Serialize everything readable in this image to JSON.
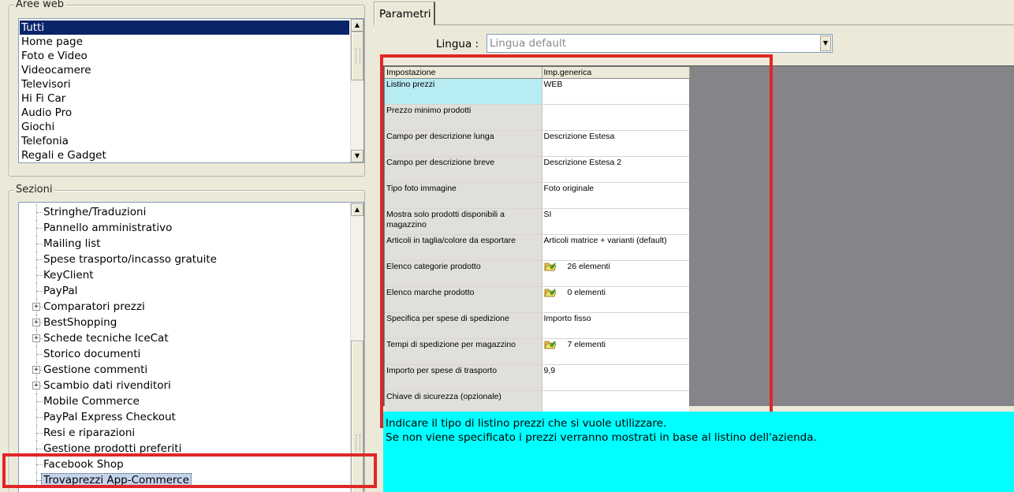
{
  "aree_web": {
    "title": "Aree web",
    "items": [
      {
        "label": "Tutti",
        "selected": true
      },
      {
        "label": "Home page"
      },
      {
        "label": "Foto e Video"
      },
      {
        "label": "Videocamere"
      },
      {
        "label": "Televisori"
      },
      {
        "label": "Hi Fi Car"
      },
      {
        "label": "Audio Pro"
      },
      {
        "label": "Giochi"
      },
      {
        "label": "Telefonia"
      },
      {
        "label": "Regali e Gadget"
      }
    ]
  },
  "sezioni": {
    "title": "Sezioni",
    "items": [
      {
        "label": "Stringhe/Traduzioni",
        "expandable": false
      },
      {
        "label": "Pannello amministrativo",
        "expandable": false
      },
      {
        "label": "Mailing list",
        "expandable": false
      },
      {
        "label": "Spese trasporto/incasso gratuite",
        "expandable": false
      },
      {
        "label": "KeyClient",
        "expandable": false
      },
      {
        "label": "PayPal",
        "expandable": false
      },
      {
        "label": "Comparatori prezzi",
        "expandable": true
      },
      {
        "label": "BestShopping",
        "expandable": true
      },
      {
        "label": "Schede tecniche IceCat",
        "expandable": true
      },
      {
        "label": "Storico documenti",
        "expandable": false
      },
      {
        "label": "Gestione commenti",
        "expandable": true
      },
      {
        "label": "Scambio dati rivenditori",
        "expandable": true
      },
      {
        "label": "Mobile Commerce",
        "expandable": false
      },
      {
        "label": "PayPal Express Checkout",
        "expandable": false
      },
      {
        "label": "Resi e riparazioni",
        "expandable": false
      },
      {
        "label": "Gestione prodotti preferiti",
        "expandable": false
      },
      {
        "label": "Facebook Shop",
        "expandable": false
      },
      {
        "label": "Trovaprezzi App-Commerce",
        "expandable": false,
        "selected": true
      }
    ]
  },
  "tab": {
    "label": "Parametri"
  },
  "lingua": {
    "label": "Lingua :",
    "value": "Lingua default"
  },
  "grid": {
    "headers": {
      "key": "Impostazione",
      "value": "Imp.generica"
    },
    "rows": [
      {
        "key": "Listino prezzi",
        "value": "WEB",
        "icon": false
      },
      {
        "key": "Prezzo minimo prodotti",
        "value": "",
        "icon": false
      },
      {
        "key": "Campo per descrizione lunga",
        "value": "Descrizione Estesa",
        "icon": false
      },
      {
        "key": "Campo per descrizione breve",
        "value": "Descrizione Estesa 2",
        "icon": false
      },
      {
        "key": "Tipo foto immagine",
        "value": "Foto originale",
        "icon": false
      },
      {
        "key": "Mostra solo prodotti disponibili a magazzino",
        "value": "SI",
        "icon": false
      },
      {
        "key": "Articoli in taglia/colore da esportare",
        "value": "Articoli matrice + varianti (default)",
        "icon": false
      },
      {
        "key": "Elenco categorie prodotto",
        "value": "26 elementi",
        "icon": true
      },
      {
        "key": "Elenco marche prodotto",
        "value": "0 elementi",
        "icon": true
      },
      {
        "key": "Specifica per spese di spedizione",
        "value": "Importo fisso",
        "icon": false
      },
      {
        "key": "Tempi di spedizione per magazzino",
        "value": "7 elementi",
        "icon": true
      },
      {
        "key": "Importo per spese di trasporto",
        "value": "9,9",
        "icon": false
      },
      {
        "key": "Chiave di sicurezza (opzionale)",
        "value": "",
        "icon": false
      }
    ]
  },
  "hint": {
    "line1": "Indicare il tipo di listino prezzi che si vuole utilizzare.",
    "line2": "Se non viene specificato i prezzi verranno mostrati in base al listino dell'azienda."
  },
  "colors": {
    "highlight": "#e02626",
    "hint_background": "#00ffff",
    "active_key_cell": "#b6ecf2",
    "selected_item": "#0a246a"
  }
}
